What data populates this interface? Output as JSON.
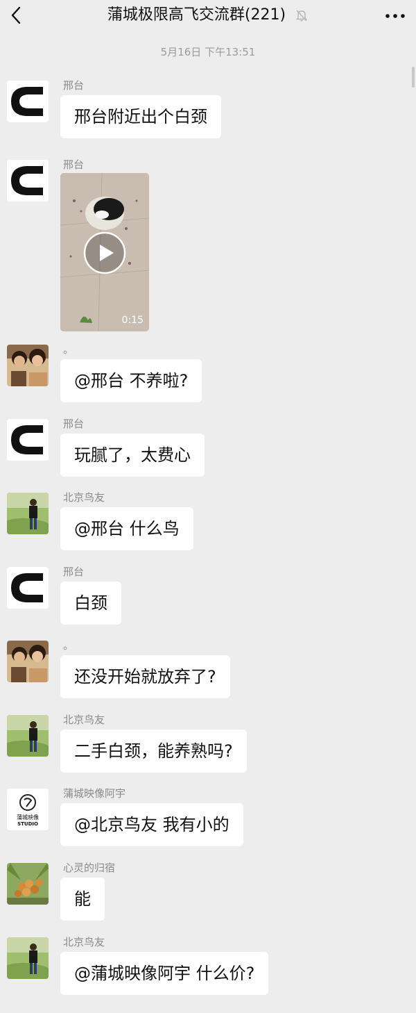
{
  "header": {
    "title": "蒲城极限高飞交流群(221)",
    "back_icon": "chevron-left-icon",
    "mute_icon": "bell-off-icon",
    "more_icon": "more-dots-icon"
  },
  "timestamp": "5月16日 下午13:51",
  "video": {
    "duration": "0:15",
    "play_icon": "play-icon"
  },
  "messages": [
    {
      "sender": "邢台",
      "text": "邢台附近出个白颈"
    },
    {
      "sender": "邢台",
      "type": "video"
    },
    {
      "sender": "。",
      "text": "@邢台  不养啦?"
    },
    {
      "sender": "邢台",
      "text": "玩腻了，太费心"
    },
    {
      "sender": "北京鸟友",
      "text": "@邢台  什么鸟"
    },
    {
      "sender": "邢台",
      "text": "白颈"
    },
    {
      "sender": "。",
      "text": "还没开始就放弃了?"
    },
    {
      "sender": "北京鸟友",
      "text": "二手白颈，能养熟吗?"
    },
    {
      "sender": "蒲城映像阿宇",
      "text": "@北京鸟友  我有小的"
    },
    {
      "sender": "心灵的归宿",
      "text": "能"
    },
    {
      "sender": "北京鸟友",
      "text": "@蒲城映像阿宇  什么价?"
    }
  ],
  "studio_logo": {
    "line1": "蒲城映像",
    "line2": "STUDIO"
  }
}
